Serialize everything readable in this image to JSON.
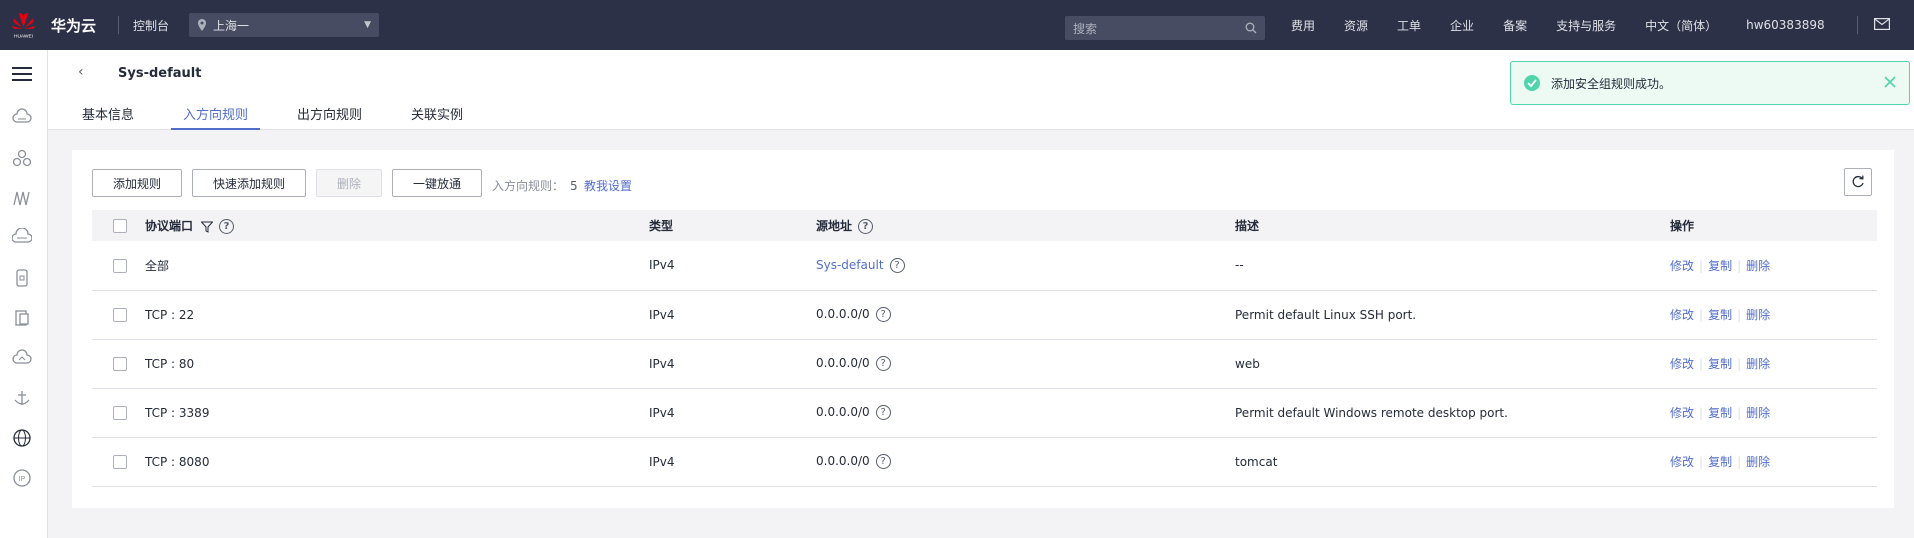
{
  "header": {
    "brand_small": "HUAWEI",
    "brand": "华为云",
    "console": "控制台",
    "region": "上海一",
    "search_placeholder": "搜索",
    "nav": [
      "费用",
      "资源",
      "工单",
      "企业",
      "备案",
      "支持与服务",
      "中文（简体）",
      "hw60383898"
    ],
    "accent_color": "#2d3147"
  },
  "page": {
    "back_glyph": "‹",
    "sg_name": "Sys-default",
    "tabs": [
      {
        "label": "基本信息",
        "active": false
      },
      {
        "label": "入方向规则",
        "active": true
      },
      {
        "label": "出方向规则",
        "active": false
      },
      {
        "label": "关联实例",
        "active": false
      }
    ]
  },
  "toast": {
    "message": "添加安全组规则成功。",
    "color": "#50d4ab"
  },
  "toolbar": {
    "add_rule": "添加规则",
    "quick_add": "快速添加规则",
    "delete": "删除",
    "allow_all": "一键放通",
    "count_label": "入方向规则：",
    "count": "5",
    "teach": "教我设置"
  },
  "table": {
    "headers": {
      "proto": "协议端口",
      "type": "类型",
      "src": "源地址",
      "desc": "描述",
      "ops": "操作"
    },
    "ops_labels": {
      "modify": "修改",
      "copy": "复制",
      "delete": "删除"
    },
    "rows": [
      {
        "proto": "全部",
        "type": "IPv4",
        "src": "Sys-default",
        "src_link": true,
        "desc": "--"
      },
      {
        "proto": "TCP : 22",
        "type": "IPv4",
        "src": "0.0.0.0/0",
        "src_link": false,
        "desc": "Permit default Linux SSH port."
      },
      {
        "proto": "TCP : 80",
        "type": "IPv4",
        "src": "0.0.0.0/0",
        "src_link": false,
        "desc": "web"
      },
      {
        "proto": "TCP : 3389",
        "type": "IPv4",
        "src": "0.0.0.0/0",
        "src_link": false,
        "desc": "Permit default Windows remote desktop port."
      },
      {
        "proto": "TCP : 8080",
        "type": "IPv4",
        "src": "0.0.0.0/0",
        "src_link": false,
        "desc": "tomcat"
      }
    ]
  },
  "rail_icons": [
    "cloud-server-icon",
    "cluster-icon",
    "network-icon",
    "database-icon",
    "phone-icon",
    "document-icon",
    "cloud-icon",
    "anchor-icon",
    "globe-icon",
    "ip-icon"
  ]
}
